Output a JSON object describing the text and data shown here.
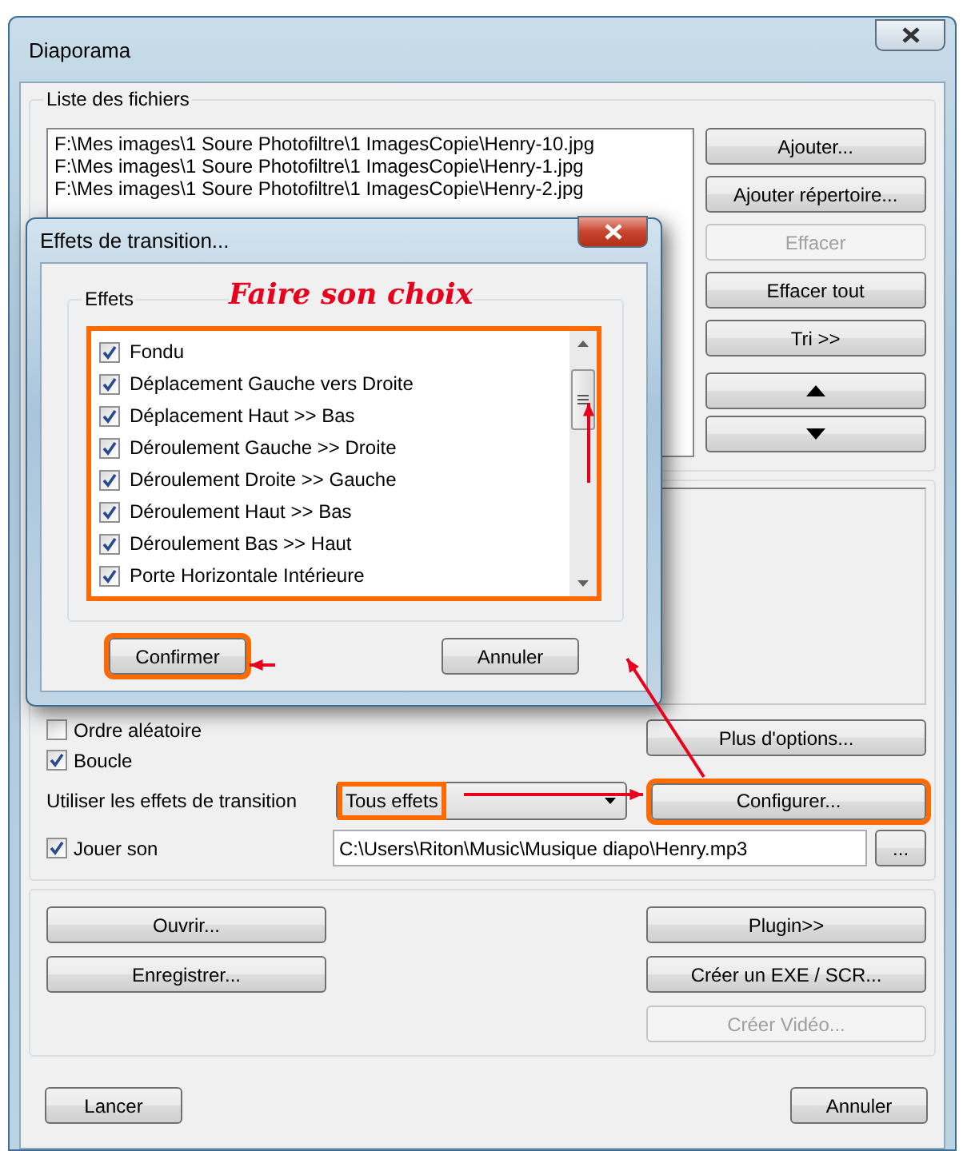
{
  "window": {
    "title": "Diaporama"
  },
  "file_list": {
    "label": "Liste des fichiers",
    "files": [
      "F:\\Mes images\\1 Soure Photofiltre\\1 ImagesCopie\\Henry-10.jpg",
      "F:\\Mes images\\1 Soure Photofiltre\\1 ImagesCopie\\Henry-1.jpg",
      "F:\\Mes images\\1 Soure Photofiltre\\1 ImagesCopie\\Henry-2.jpg"
    ],
    "buttons": [
      {
        "kind": "text",
        "label": "Ajouter...",
        "disabled": false
      },
      {
        "kind": "text",
        "label": "Ajouter répertoire...",
        "disabled": false
      },
      {
        "kind": "text",
        "label": "Effacer",
        "disabled": true
      },
      {
        "kind": "text",
        "label": "Effacer tout",
        "disabled": false
      },
      {
        "kind": "text",
        "label": "Tri >>",
        "disabled": false
      },
      {
        "kind": "up",
        "disabled": false
      },
      {
        "kind": "down",
        "disabled": false
      }
    ]
  },
  "options": {
    "checkboxes": [
      {
        "label": "Ordre aléatoire",
        "checked": false
      },
      {
        "label": "Boucle",
        "checked": true
      }
    ],
    "more_button": "Plus d'options...",
    "transition": {
      "label": "Utiliser les effets de transition",
      "value": "Tous effets",
      "highlighted": true
    },
    "configure_button": {
      "label": "Configurer...",
      "highlighted": true
    },
    "sound": {
      "label": "Jouer son",
      "checked": true,
      "path": "C:\\Users\\Riton\\Music\\Musique diapo\\Henry.mp3",
      "browse_button": "..."
    }
  },
  "actions": {
    "left": [
      {
        "label": "Ouvrir...",
        "disabled": false
      },
      {
        "label": "Enregistrer...",
        "disabled": false
      }
    ],
    "right": [
      {
        "label": "Plugin>>",
        "disabled": false
      },
      {
        "label": "Créer un EXE / SCR...",
        "disabled": false
      },
      {
        "label": "Créer Vidéo...",
        "disabled": true
      }
    ]
  },
  "footer": {
    "buttons": [
      "Lancer",
      "Annuler"
    ]
  },
  "dialog": {
    "title": "Effets de transition...",
    "group_label": "Effets",
    "annotation": "Faire son choix",
    "list_highlighted": true,
    "effects": [
      {
        "label": "Fondu",
        "checked": true
      },
      {
        "label": "Déplacement Gauche vers Droite",
        "checked": true
      },
      {
        "label": "Déplacement Haut >> Bas",
        "checked": true
      },
      {
        "label": "Déroulement Gauche >> Droite",
        "checked": true
      },
      {
        "label": "Déroulement Droite >> Gauche",
        "checked": true
      },
      {
        "label": "Déroulement Haut >> Bas",
        "checked": true
      },
      {
        "label": "Déroulement Bas >> Haut",
        "checked": true
      },
      {
        "label": "Porte Horizontale Intérieure",
        "checked": true
      }
    ],
    "buttons": [
      {
        "label": "Confirmer",
        "highlighted": true
      },
      {
        "label": "Annuler",
        "highlighted": false
      }
    ]
  }
}
